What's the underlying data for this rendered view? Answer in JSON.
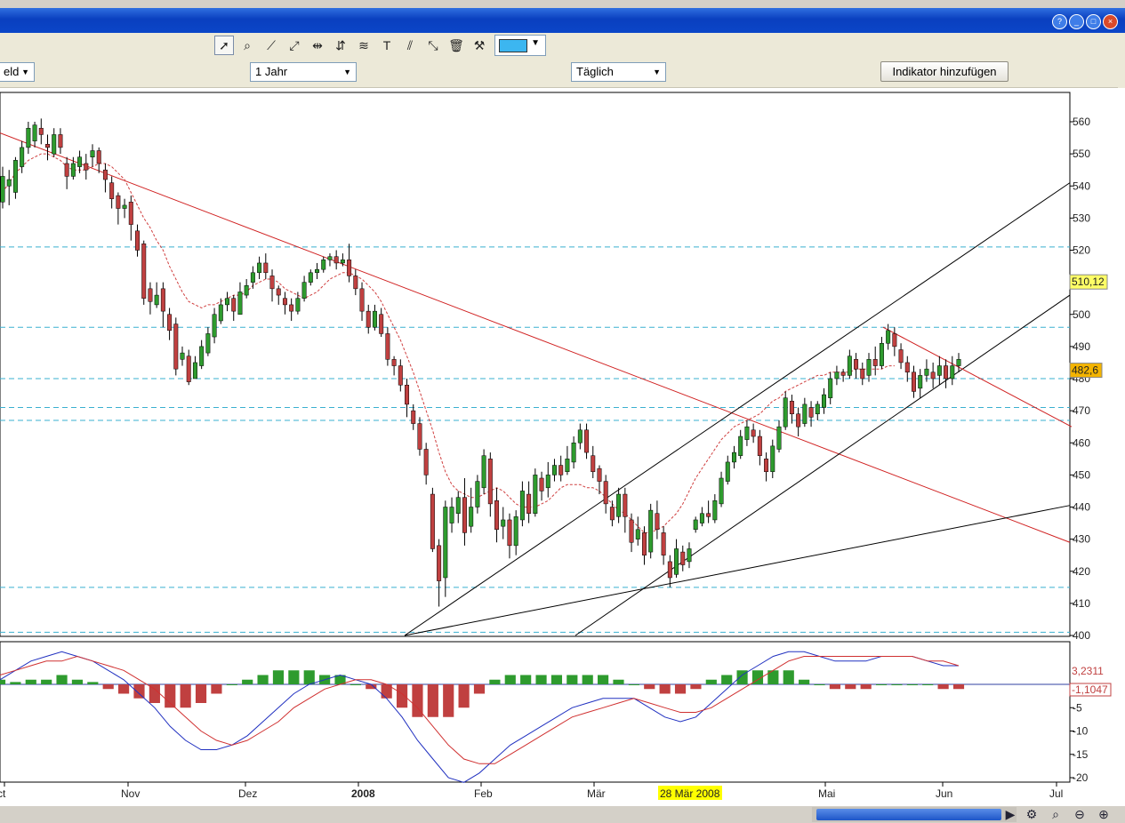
{
  "toolbar": {
    "icons": [
      "cursor-icon",
      "zoom-icon",
      "line-icon",
      "trendline-icon",
      "horizontal-line-icon",
      "vertical-line-icon",
      "fibonacci-icon",
      "text-icon",
      "parallel-lines-icon",
      "expand-icon",
      "trash-icon",
      "tools-icon"
    ],
    "color": "#3cb6f0"
  },
  "options": {
    "left_select": "eld",
    "period_select": "1 Jahr",
    "interval_select": "Täglich",
    "add_indicator": "Indikator hinzufügen"
  },
  "chart_data": {
    "type": "candlestick",
    "price_axis": {
      "min": 400,
      "max": 560,
      "ticks": [
        "560",
        "550",
        "540",
        "530",
        "520",
        "510",
        "500",
        "490",
        "480",
        "470",
        "460",
        "450",
        "440",
        "430",
        "420",
        "410",
        "400"
      ]
    },
    "price_labels": {
      "current": "482,6",
      "marker": "510,12"
    },
    "macd_axis": {
      "ticks": [
        "-5",
        "-10",
        "-15",
        "-20"
      ]
    },
    "macd_labels": {
      "value_a": "3,2311",
      "value_b": "-1,1047"
    },
    "x_ticks": [
      "ct",
      "Nov",
      "Dez",
      "2008",
      "Feb",
      "Mär",
      "Mai",
      "Jun",
      "Jul"
    ],
    "x_highlight": "28 Mär 2008",
    "horizontal_levels": [
      521,
      496,
      480,
      471,
      467,
      415,
      401
    ],
    "candles": [
      [
        535,
        543,
        533,
        546
      ],
      [
        540,
        542,
        534,
        545
      ],
      [
        538,
        548,
        536,
        549
      ],
      [
        546,
        552,
        544,
        554
      ],
      [
        552,
        558,
        550,
        560
      ],
      [
        554,
        559,
        552,
        560
      ],
      [
        558,
        556,
        553,
        561
      ],
      [
        553,
        552,
        548,
        556
      ],
      [
        550,
        556,
        549,
        558
      ],
      [
        556,
        552,
        550,
        558
      ],
      [
        547,
        543,
        539,
        549
      ],
      [
        543,
        547,
        542,
        549
      ],
      [
        546,
        549,
        544,
        551
      ],
      [
        547,
        545,
        542,
        550
      ],
      [
        549,
        551,
        546,
        553
      ],
      [
        551,
        547,
        544,
        552
      ],
      [
        545,
        542,
        538,
        547
      ],
      [
        541,
        536,
        533,
        543
      ],
      [
        537,
        533,
        528,
        538
      ],
      [
        533,
        534,
        530,
        536
      ],
      [
        535,
        528,
        523,
        537
      ],
      [
        526,
        520,
        518,
        528
      ],
      [
        522,
        505,
        503,
        523
      ],
      [
        508,
        504,
        500,
        510
      ],
      [
        503,
        506,
        502,
        510
      ],
      [
        508,
        501,
        496,
        510
      ],
      [
        500,
        495,
        492,
        502
      ],
      [
        497,
        483,
        481,
        499
      ],
      [
        486,
        488,
        484,
        490
      ],
      [
        487,
        479,
        478,
        489
      ],
      [
        480,
        485,
        480,
        487
      ],
      [
        484,
        490,
        483,
        492
      ],
      [
        488,
        494,
        487,
        496
      ],
      [
        493,
        500,
        491,
        502
      ],
      [
        498,
        503,
        497,
        505
      ],
      [
        503,
        505,
        501,
        507
      ],
      [
        505,
        501,
        498,
        506
      ],
      [
        500,
        507,
        500,
        510
      ],
      [
        506,
        509,
        505,
        511
      ],
      [
        510,
        513,
        508,
        515
      ],
      [
        513,
        516,
        511,
        518
      ],
      [
        516,
        513,
        511,
        519
      ],
      [
        512,
        508,
        504,
        514
      ],
      [
        508,
        506,
        503,
        509
      ],
      [
        505,
        503,
        500,
        507
      ],
      [
        503,
        501,
        498,
        505
      ],
      [
        501,
        505,
        500,
        507
      ],
      [
        505,
        510,
        504,
        512
      ],
      [
        510,
        513,
        509,
        514
      ],
      [
        513,
        514,
        511,
        516
      ],
      [
        514,
        517,
        513,
        518
      ],
      [
        517,
        518,
        515,
        519
      ],
      [
        518,
        516,
        514,
        520
      ],
      [
        516,
        517,
        515,
        519
      ],
      [
        517,
        512,
        510,
        522
      ],
      [
        512,
        508,
        506,
        514
      ],
      [
        508,
        501,
        498,
        510
      ],
      [
        501,
        496,
        494,
        503
      ],
      [
        496,
        501,
        495,
        503
      ],
      [
        500,
        494,
        493,
        502
      ],
      [
        494,
        486,
        484,
        496
      ],
      [
        486,
        484,
        481,
        487
      ],
      [
        484,
        478,
        476,
        486
      ],
      [
        478,
        472,
        468,
        480
      ],
      [
        470,
        466,
        464,
        472
      ],
      [
        466,
        458,
        456,
        468
      ],
      [
        458,
        450,
        447,
        460
      ],
      [
        444,
        427,
        426,
        446
      ],
      [
        428,
        417,
        409,
        430
      ],
      [
        418,
        440,
        412,
        442
      ],
      [
        435,
        440,
        432,
        443
      ],
      [
        438,
        443,
        435,
        445
      ],
      [
        443,
        432,
        428,
        449
      ],
      [
        434,
        440,
        432,
        446
      ],
      [
        440,
        448,
        438,
        450
      ],
      [
        446,
        456,
        444,
        458
      ],
      [
        455,
        441,
        437,
        457
      ],
      [
        442,
        433,
        429,
        446
      ],
      [
        434,
        436,
        430,
        440
      ],
      [
        436,
        428,
        424,
        438
      ],
      [
        428,
        437,
        425,
        439
      ],
      [
        436,
        445,
        434,
        448
      ],
      [
        444,
        438,
        435,
        448
      ],
      [
        438,
        450,
        437,
        452
      ],
      [
        449,
        445,
        442,
        451
      ],
      [
        446,
        450,
        443,
        454
      ],
      [
        450,
        453,
        448,
        455
      ],
      [
        453,
        450,
        448,
        456
      ],
      [
        451,
        455,
        450,
        459
      ],
      [
        454,
        460,
        452,
        462
      ],
      [
        460,
        464,
        458,
        466
      ],
      [
        464,
        457,
        455,
        466
      ],
      [
        456,
        451,
        449,
        459
      ],
      [
        452,
        448,
        444,
        453
      ],
      [
        448,
        441,
        438,
        450
      ],
      [
        440,
        436,
        434,
        442
      ],
      [
        437,
        444,
        435,
        446
      ],
      [
        444,
        437,
        432,
        446
      ],
      [
        436,
        429,
        426,
        438
      ],
      [
        430,
        433,
        428,
        437
      ],
      [
        432,
        425,
        422,
        434
      ],
      [
        426,
        439,
        424,
        441
      ],
      [
        438,
        433,
        430,
        442
      ],
      [
        432,
        425,
        422,
        434
      ],
      [
        423,
        418,
        415,
        425
      ],
      [
        419,
        427,
        418,
        430
      ],
      [
        426,
        422,
        420,
        428
      ],
      [
        423,
        427,
        421,
        429
      ],
      [
        433,
        436,
        432,
        437
      ],
      [
        435,
        438,
        434,
        440
      ],
      [
        438,
        437,
        435,
        442
      ],
      [
        436,
        442,
        435,
        444
      ],
      [
        441,
        449,
        440,
        451
      ],
      [
        448,
        454,
        447,
        456
      ],
      [
        454,
        457,
        452,
        459
      ],
      [
        456,
        462,
        455,
        464
      ],
      [
        461,
        465,
        459,
        467
      ],
      [
        464,
        462,
        460,
        466
      ],
      [
        462,
        456,
        453,
        464
      ],
      [
        455,
        451,
        448,
        457
      ],
      [
        451,
        459,
        449,
        461
      ],
      [
        458,
        465,
        457,
        467
      ],
      [
        465,
        474,
        464,
        476
      ],
      [
        473,
        469,
        466,
        475
      ],
      [
        469,
        465,
        462,
        471
      ],
      [
        466,
        472,
        465,
        474
      ],
      [
        471,
        468,
        465,
        473
      ],
      [
        469,
        472,
        467,
        473
      ],
      [
        471,
        475,
        469,
        477
      ],
      [
        474,
        480,
        472,
        482
      ],
      [
        480,
        482,
        478,
        484
      ],
      [
        482,
        481,
        479,
        483
      ],
      [
        481,
        487,
        480,
        489
      ],
      [
        486,
        483,
        480,
        488
      ],
      [
        483,
        480,
        478,
        485
      ],
      [
        481,
        486,
        479,
        488
      ],
      [
        486,
        484,
        481,
        490
      ],
      [
        484,
        491,
        483,
        493
      ],
      [
        491,
        495,
        489,
        497
      ],
      [
        494,
        490,
        487,
        496
      ],
      [
        489,
        485,
        483,
        491
      ],
      [
        485,
        482,
        479,
        487
      ],
      [
        482,
        476,
        474,
        484
      ],
      [
        477,
        481,
        474,
        483
      ],
      [
        481,
        483,
        479,
        486
      ],
      [
        482,
        480,
        477,
        485
      ],
      [
        481,
        484,
        478,
        487
      ],
      [
        484,
        480,
        477,
        486
      ],
      [
        480,
        484,
        478,
        487
      ],
      [
        484,
        486,
        482,
        488
      ]
    ],
    "moving_average": [
      538,
      541,
      544,
      546,
      548,
      549,
      550,
      550,
      549,
      548,
      546,
      545,
      545,
      545,
      546,
      547,
      547,
      546,
      544,
      542,
      538,
      534,
      530,
      527,
      523,
      520,
      515,
      511,
      507,
      504,
      503,
      502,
      503,
      503,
      504,
      505,
      506,
      506,
      507,
      509,
      510,
      511,
      511,
      510,
      508,
      507,
      506,
      505,
      506,
      507,
      509,
      511,
      512,
      513,
      513,
      512,
      511,
      509,
      507,
      504,
      500,
      496,
      492,
      487,
      482,
      476,
      470,
      464,
      457,
      451,
      447,
      445,
      444,
      443,
      443,
      444,
      445,
      446,
      445,
      443,
      441,
      440,
      440,
      440,
      441,
      442,
      444,
      446,
      447,
      447,
      447,
      446,
      446,
      445,
      443,
      441,
      439,
      438,
      436,
      434,
      432,
      432,
      433,
      434,
      436,
      438,
      441,
      445,
      449,
      452,
      455,
      458,
      461,
      463,
      465,
      466,
      467,
      468,
      469,
      471,
      473,
      474,
      476,
      477,
      478,
      479,
      480,
      481,
      481,
      482,
      482,
      482,
      482,
      483,
      483,
      483,
      483,
      483,
      484,
      484
    ],
    "macd_line": [
      1,
      3,
      5,
      6,
      7,
      6,
      5,
      3,
      1,
      -2,
      -5,
      -9,
      -12,
      -14,
      -14,
      -13,
      -11,
      -8,
      -5,
      -2,
      0,
      1,
      2,
      1,
      0,
      -3,
      -7,
      -12,
      -16,
      -20,
      -21,
      -19,
      -16,
      -13,
      -11,
      -9,
      -7,
      -5,
      -4,
      -3,
      -3,
      -3,
      -5,
      -7,
      -8,
      -7,
      -4,
      -1,
      2,
      4,
      6,
      7,
      7,
      6,
      5,
      5,
      5,
      6,
      6,
      6,
      5,
      4,
      4
    ],
    "signal_line": [
      2,
      3,
      4,
      5,
      5,
      6,
      5,
      4,
      3,
      1,
      -1,
      -4,
      -7,
      -10,
      -12,
      -13,
      -12,
      -10,
      -8,
      -5,
      -3,
      -1,
      0,
      1,
      1,
      0,
      -2,
      -5,
      -9,
      -13,
      -16,
      -17,
      -17,
      -15,
      -13,
      -11,
      -9,
      -7,
      -6,
      -5,
      -4,
      -3,
      -4,
      -5,
      -6,
      -6,
      -5,
      -3,
      -1,
      1,
      3,
      5,
      6,
      6,
      6,
      6,
      6,
      6,
      6,
      6,
      5,
      5,
      4
    ],
    "histogram": [
      1,
      0.5,
      1,
      1,
      2,
      1,
      0.5,
      -1,
      -2,
      -3,
      -4,
      -5,
      -5,
      -4,
      -2,
      0,
      1,
      2,
      3,
      3,
      3,
      2,
      2,
      0,
      -1,
      -3,
      -5,
      -7,
      -7,
      -7,
      -5,
      -2,
      1,
      2,
      2,
      2,
      2,
      2,
      2,
      2,
      1,
      0,
      -1,
      -2,
      -2,
      -1,
      1,
      2,
      3,
      3,
      3,
      3,
      1,
      0,
      -1,
      -1,
      -1,
      0,
      0,
      0,
      0,
      -1,
      -1
    ]
  },
  "colors": {
    "up": "#2e9b2e",
    "down": "#c04040",
    "ma": "#d04040",
    "grid": "#3ab0d0"
  }
}
